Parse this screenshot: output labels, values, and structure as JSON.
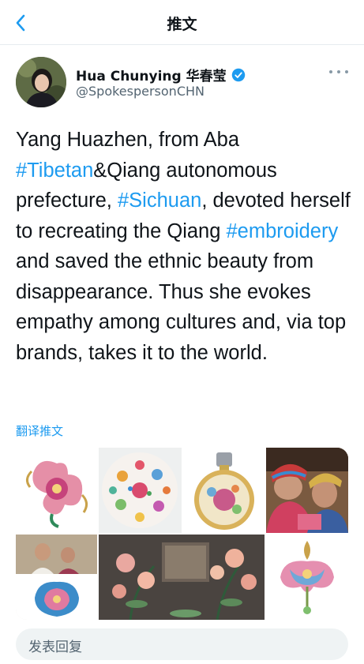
{
  "nav": {
    "title": "推文"
  },
  "author": {
    "name": "Hua Chunying 华春莹",
    "handle": "@SpokespersonCHN",
    "verified": true
  },
  "tweet": {
    "segments": [
      {
        "text": "Yang Huazhen, from Aba ",
        "type": "text"
      },
      {
        "text": "#Tibetan",
        "type": "hashtag"
      },
      {
        "text": "&Qiang autonomous prefecture, ",
        "type": "text"
      },
      {
        "text": "#Sichuan",
        "type": "hashtag"
      },
      {
        "text": ", devoted herself to recreating the Qiang ",
        "type": "text"
      },
      {
        "text": "#embroidery",
        "type": "hashtag"
      },
      {
        "text": " and saved the ethnic beauty from disappearance. Thus she evokes empathy among cultures and, via top brands, takes it to the world.",
        "type": "text"
      }
    ],
    "translate_label": "翻译推文"
  },
  "reply": {
    "placeholder": "发表回复"
  },
  "colors": {
    "link": "#1d9bf0",
    "text": "#0f1419",
    "muted": "#536471"
  }
}
